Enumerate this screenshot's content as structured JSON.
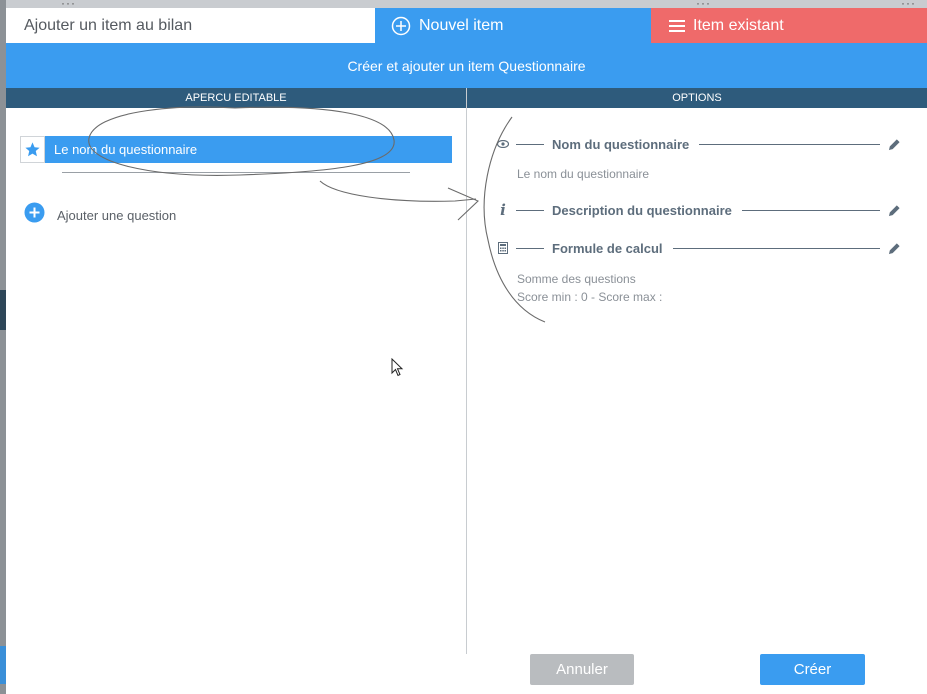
{
  "tabs": {
    "title": "Ajouter un item au bilan",
    "new_item": "Nouvel item",
    "existing_item": "Item existant"
  },
  "subheader": "Créer et ajouter un item Questionnaire",
  "columns": {
    "left": "APERCU EDITABLE",
    "right": "OPTIONS"
  },
  "preview": {
    "name": "Le nom du questionnaire",
    "add_question": "Ajouter une question"
  },
  "options": {
    "name": {
      "icon": "eye-icon",
      "label": "Nom du questionnaire",
      "value": "Le nom du questionnaire"
    },
    "description": {
      "icon": "info-icon",
      "label": "Description du questionnaire"
    },
    "formula": {
      "icon": "calculator-icon",
      "label": "Formule de calcul",
      "value_line1": "Somme des questions",
      "value_line2": "Score min : 0 - Score max :"
    }
  },
  "buttons": {
    "cancel": "Annuler",
    "create": "Créer"
  },
  "colors": {
    "primary": "#3a9cf0",
    "danger": "#ef6a6a",
    "header_dark": "#2e5b7c",
    "option_text": "#5d6d7c",
    "cancel": "#b9bcbf"
  }
}
